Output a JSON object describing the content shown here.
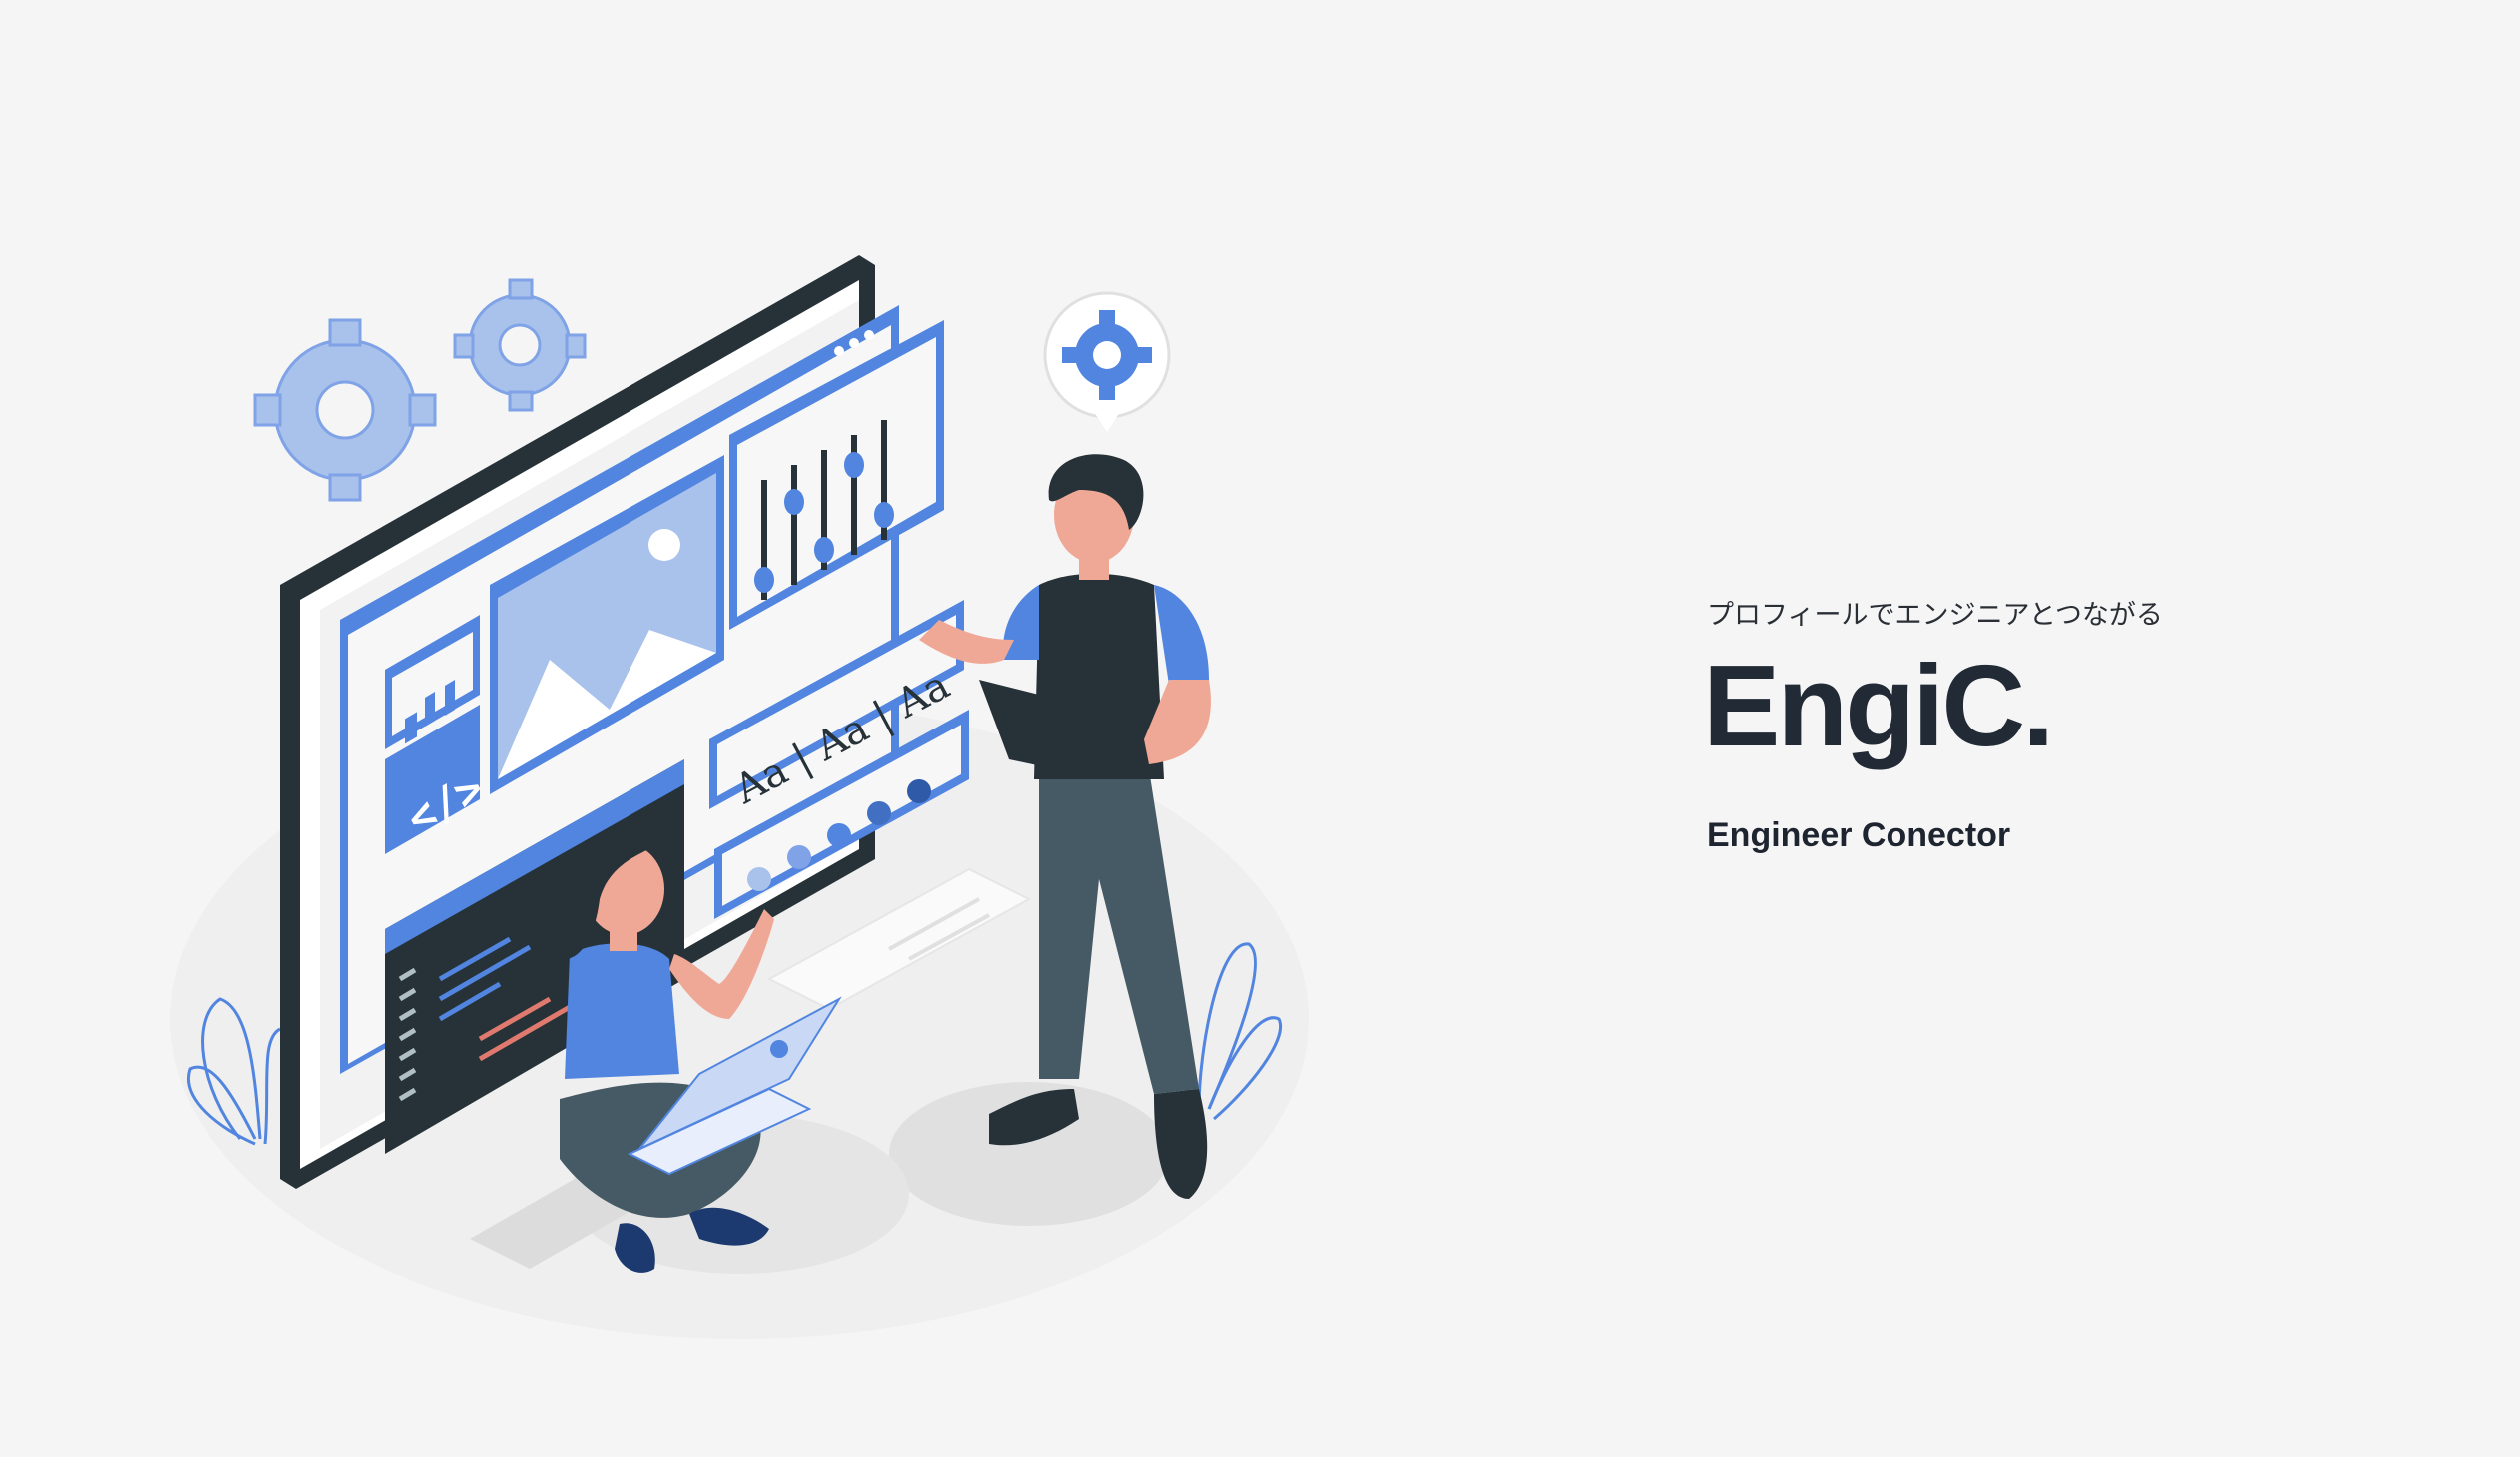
{
  "hero": {
    "tagline": "プロフィールでエンジニアとつながる",
    "logo_text": "EngiC.",
    "subtitle": "Engineer Conector",
    "illustration": {
      "subject": "two engineers building a web interface",
      "icons": [
        "gear-icon",
        "code-icon",
        "image-icon",
        "bar-chart-icon",
        "sliders-icon",
        "laptop-icon",
        "tablet-icon"
      ],
      "font_samples": [
        "Aa",
        "Aa",
        "Aa"
      ],
      "code_glyph": "</>"
    }
  },
  "colors": {
    "background": "#f5f5f5",
    "accent_blue": "#5185e0",
    "light_blue": "#a9c2ec",
    "dark_navy": "#263238",
    "text_dark": "#212a35"
  }
}
